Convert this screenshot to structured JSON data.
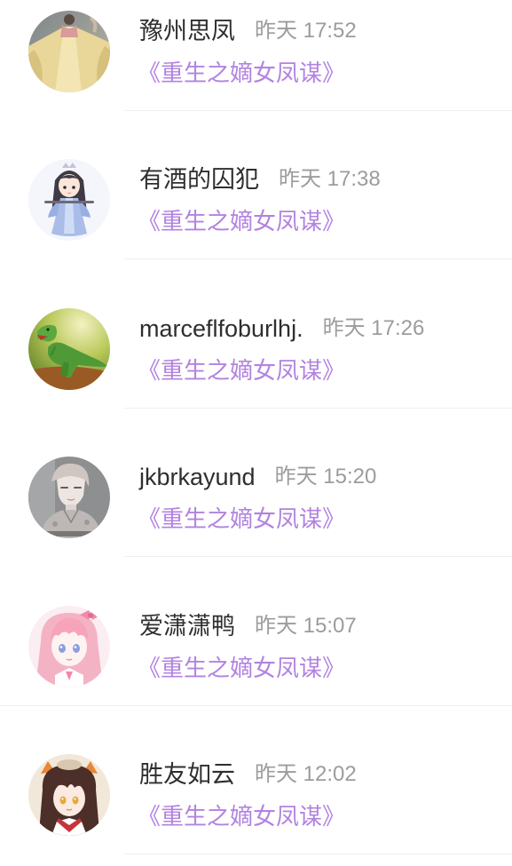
{
  "colors": {
    "username": "#2e2e2e",
    "time": "#9c9c9c",
    "book": "#b283e0",
    "divider": "#efefef",
    "background": "#ffffff"
  },
  "comments": [
    {
      "user": "豫州思凤",
      "time": "昨天 17:52",
      "book": "《重生之嫡女凤谋》"
    },
    {
      "user": "有酒的囚犯",
      "time": "昨天 17:38",
      "book": "《重生之嫡女凤谋》"
    },
    {
      "user": "marceflfoburlhj.",
      "time": "昨天 17:26",
      "book": "《重生之嫡女凤谋》"
    },
    {
      "user": "jkbrkayund",
      "time": "昨天 15:20",
      "book": "《重生之嫡女凤谋》"
    },
    {
      "user": "爱潇潇鸭",
      "time": "昨天 15:07",
      "book": "《重生之嫡女凤谋》"
    },
    {
      "user": "胜友如云",
      "time": "昨天 12:02",
      "book": "《重生之嫡女凤谋》"
    }
  ]
}
